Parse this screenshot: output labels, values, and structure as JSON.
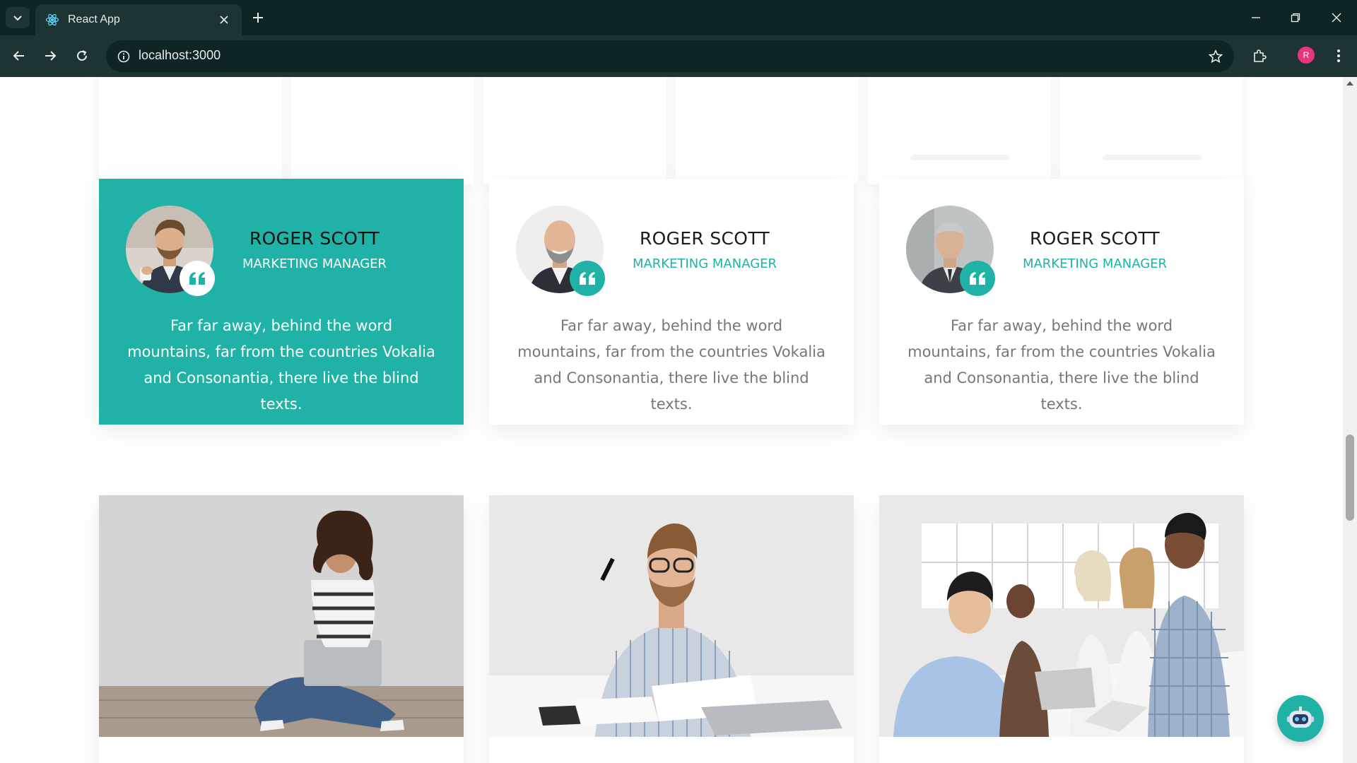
{
  "browser": {
    "tab_title": "React App",
    "url": "localhost:3000",
    "profile_initial": "R"
  },
  "colors": {
    "accent": "#20b2a6",
    "chrome_dark": "#0f2424",
    "chrome_mid": "#1e3333",
    "profile": "#e9357e"
  },
  "icons": {
    "tab_favicon": "react-icon",
    "quote": "quote-icon",
    "chatbot": "robot-icon"
  },
  "testimonials": [
    {
      "name": "ROGER SCOTT",
      "role": "MARKETING MANAGER",
      "text": "Far far away, behind the word mountains, far from the countries Vokalia and Consonantia, there live the blind texts.",
      "active": true
    },
    {
      "name": "ROGER SCOTT",
      "role": "MARKETING MANAGER",
      "text": "Far far away, behind the word mountains, far from the countries Vokalia and Consonantia, there live the blind texts.",
      "active": false
    },
    {
      "name": "ROGER SCOTT",
      "role": "MARKETING MANAGER",
      "text": "Far far away, behind the word mountains, far from the countries Vokalia and Consonantia, there live the blind texts.",
      "active": false
    }
  ]
}
